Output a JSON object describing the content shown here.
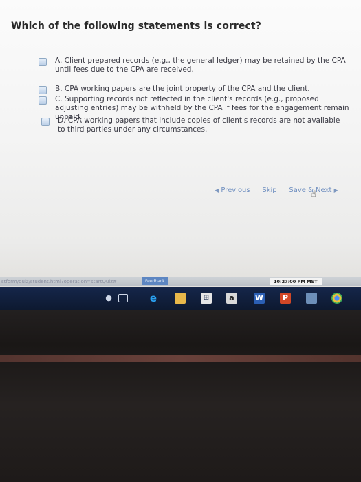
{
  "question": {
    "text": "Which of the following statements is correct?"
  },
  "options": [
    {
      "label": "A. Client prepared records (e.g., the general ledger) may be retained by the CPA until fees due to the CPA are received."
    },
    {
      "label": "B. CPA working papers are the joint property of the CPA and the client."
    },
    {
      "label": "C. Supporting records not reflected in the client's records (e.g., proposed adjusting entries) may be withheld by the CPA if fees for the engagement remain unpaid."
    },
    {
      "label": "D. CPA working papers that include copies of client's records are not available to third parties under any circumstances."
    }
  ],
  "nav": {
    "previous": "Previous",
    "skip": "Skip",
    "save_next": "Save & Next",
    "sep": "|"
  },
  "statusbar": {
    "url": "stform/quiz/student.html?operation=startQuiz#",
    "feedback": "Feedback",
    "time": "10:27:00 PM MST"
  },
  "taskbar": {
    "icons": [
      "microphone-icon",
      "task-view-icon",
      "edge-icon",
      "file-explorer-icon",
      "store-icon",
      "amazon-icon",
      "word-icon",
      "powerpoint-icon",
      "photos-icon",
      "chrome-icon"
    ],
    "amazon_letter": "a",
    "word_letter": "W",
    "powerpoint_letter": "P"
  },
  "colors": {
    "link": "#6f8fc0",
    "taskbar": "#15264a",
    "checkbox": "#8fa9c4"
  }
}
